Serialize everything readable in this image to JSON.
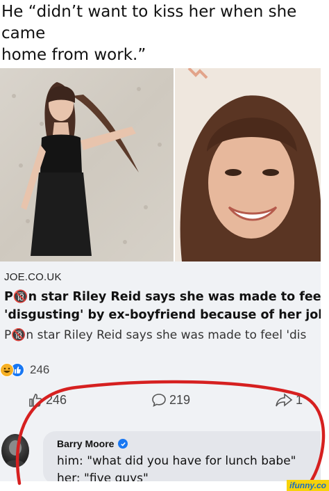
{
  "caption": {
    "line1": "He “didn’t want to kiss her when she came",
    "line2": "home from work.”"
  },
  "post": {
    "link": {
      "domain": "JOE.CO.UK",
      "headline_line1": "P🔞n star Riley Reid says she was made to feel",
      "headline_line2": "'disgusting' by ex-boyfriend because of her job | J",
      "subline": "P🔞n star Riley Reid says she was made to feel 'dis"
    },
    "reactions": {
      "count": "246"
    },
    "actions": {
      "like_count": "246",
      "comment_count": "219",
      "share_count": "1"
    },
    "comment": {
      "author": "Barry Moore",
      "line1": "him: \"what did you have for lunch babe\"",
      "line2": "her: \"five guys\""
    }
  },
  "colors": {
    "annotation_red": "#d62020",
    "facebook_blue": "#1877f2",
    "card_background": "#f0f2f5",
    "bubble_background": "#e4e6eb"
  },
  "watermark": "ifunny.co"
}
